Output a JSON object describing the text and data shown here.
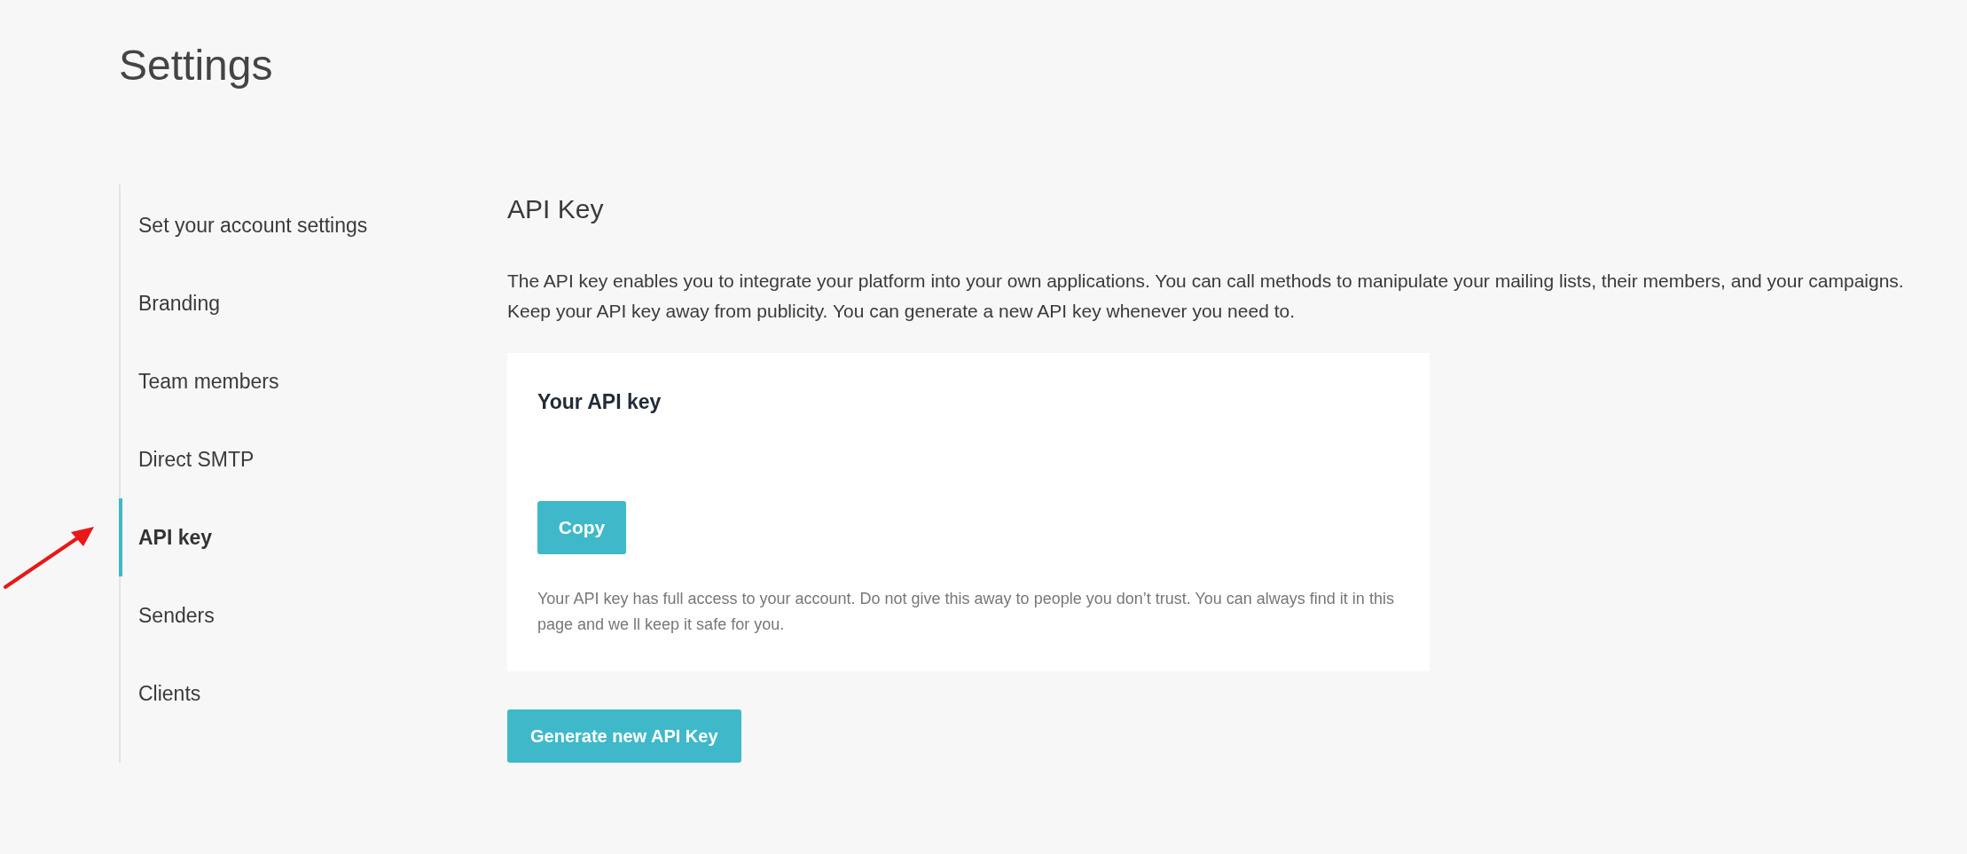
{
  "page_title": "Settings",
  "sidebar": {
    "items": [
      {
        "label": "Set your account settings",
        "selected": false
      },
      {
        "label": "Branding",
        "selected": false
      },
      {
        "label": "Team members",
        "selected": false
      },
      {
        "label": "Direct SMTP",
        "selected": false
      },
      {
        "label": "API key",
        "selected": true
      },
      {
        "label": "Senders",
        "selected": false
      },
      {
        "label": "Clients",
        "selected": false
      }
    ]
  },
  "section": {
    "title": "API Key",
    "description": "The API key enables you to integrate your platform into your own applications. You can call methods to manipulate your mailing lists, their members, and your campaigns. Keep your API key away from publicity. You can generate a new API key whenever you need to.",
    "card": {
      "title": "Your API key",
      "copy_button": "Copy",
      "note": "Your API key has full access to your account. Do not give this away to people you don’t trust. You can always find it in this page and we ll keep it safe for you."
    },
    "generate_button": "Generate new API Key"
  }
}
